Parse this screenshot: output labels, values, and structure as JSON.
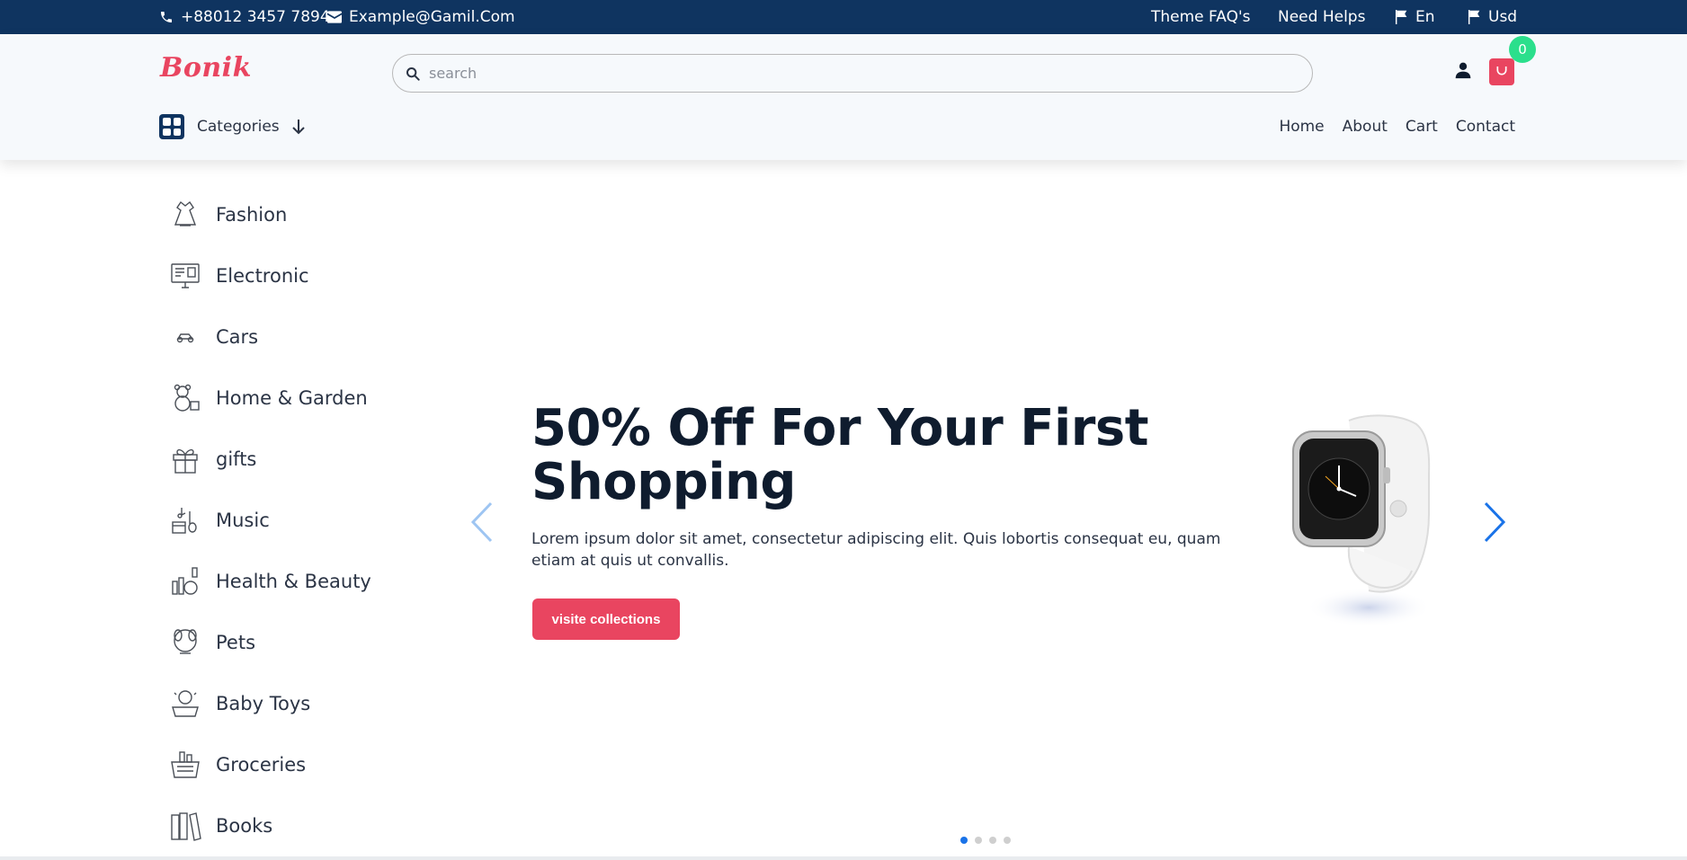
{
  "topbar": {
    "phone": "+88012 3457 7894",
    "email": "Example@Gamil.Com",
    "faq": "Theme FAQ's",
    "help": "Need Helps",
    "language": "En",
    "currency": "Usd"
  },
  "header": {
    "logo": "Bonik",
    "search_placeholder": "search",
    "cart_count": "0",
    "categories_label": "Categories",
    "nav": [
      "Home",
      "About",
      "Cart",
      "Contact"
    ]
  },
  "sidebar": {
    "items": [
      {
        "label": "Fashion",
        "icon": "dress-icon"
      },
      {
        "label": "Electronic",
        "icon": "monitor-icon"
      },
      {
        "label": "Cars",
        "icon": "car-icon"
      },
      {
        "label": "Home & Garden",
        "icon": "teddy-bear-icon"
      },
      {
        "label": "gifts",
        "icon": "gift-icon"
      },
      {
        "label": "Music",
        "icon": "music-icon"
      },
      {
        "label": "Health & Beauty",
        "icon": "cosmetics-icon"
      },
      {
        "label": "Pets",
        "icon": "pet-icon"
      },
      {
        "label": "Baby Toys",
        "icon": "baby-icon"
      },
      {
        "label": "Groceries",
        "icon": "basket-icon"
      },
      {
        "label": "Books",
        "icon": "books-icon"
      }
    ]
  },
  "hero": {
    "title": "50% Off For Your First Shopping",
    "description": "Lorem ipsum dolor sit amet, consectetur adipiscing elit. Quis lobortis consequat eu, quam etiam at quis ut convallis.",
    "button": "visite collections",
    "slide_count": 4,
    "active_slide": 1
  },
  "colors": {
    "topbar": "#0f3460",
    "accent": "#e94560",
    "badge": "#2bdf8c",
    "carousel_arrow": "#1a73e8"
  }
}
